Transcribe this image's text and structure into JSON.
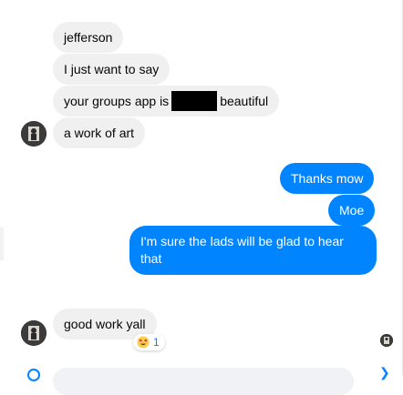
{
  "messages": {
    "incoming_1": "jefferson",
    "incoming_2": "I just want to say",
    "incoming_3_before": "your groups app is",
    "incoming_3_after": "beautiful",
    "incoming_4": "a work of art",
    "outgoing_1": "Thanks mow",
    "outgoing_2": "Moe",
    "outgoing_3": "I'm sure the lads will be glad to hear that",
    "incoming_5": "good work yall"
  },
  "reaction": {
    "emoji": "heart-eyes-emoji",
    "count": "1"
  },
  "colors": {
    "incoming_bubble": "#f0f0f0",
    "outgoing_bubble": "#0084ff",
    "redaction": "#000000"
  },
  "icons": [
    "avatar",
    "read-receipt-avatar",
    "emoji-icon",
    "send-icon"
  ]
}
